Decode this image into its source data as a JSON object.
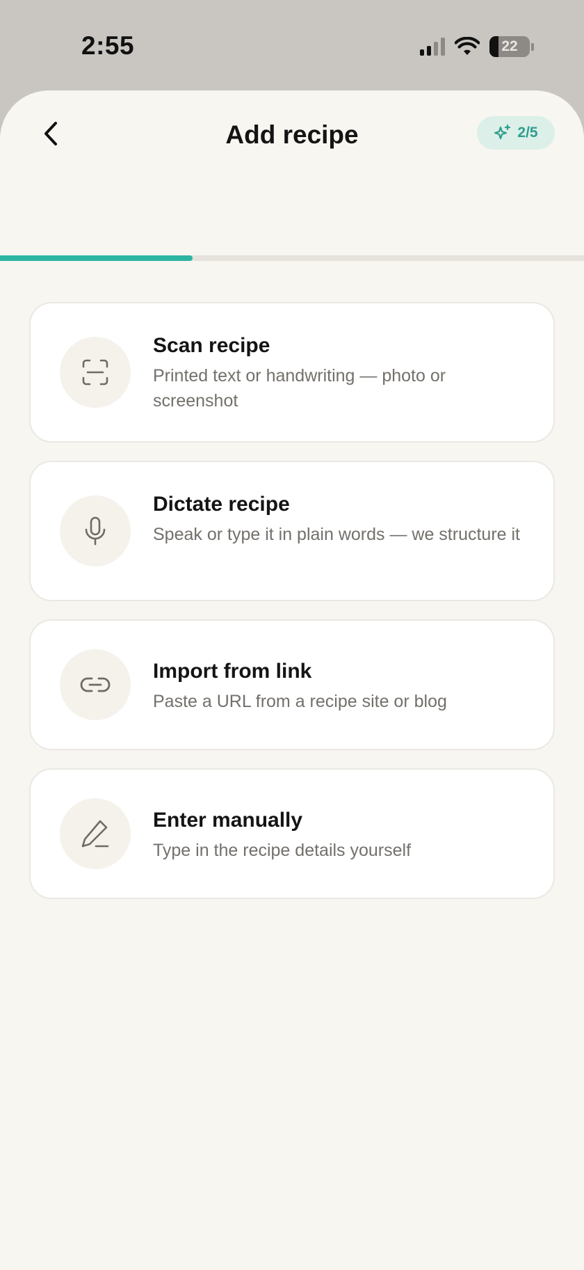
{
  "status_bar": {
    "time": "2:55",
    "battery": "22"
  },
  "header": {
    "title": "Add recipe",
    "step_indicator": "2/5",
    "back_icon": "chevron-left-icon",
    "badge_icon": "sparkles-icon"
  },
  "progress": {
    "current_step": 2,
    "total_steps": 5,
    "fraction": 0.33
  },
  "colors": {
    "accent": "#2eb5a1",
    "background": "#f8f6f1",
    "badge_bg": "#dcefe9"
  },
  "options": [
    {
      "title": "Scan recipe",
      "description": "Printed text or handwriting — photo or screenshot",
      "icon": "scan-icon"
    },
    {
      "title": "Dictate recipe",
      "description": "Speak or type it in plain words — we structure it",
      "icon": "microphone-icon"
    },
    {
      "title": "Import from link",
      "description": "Paste a URL from a recipe site or blog",
      "icon": "link-icon"
    },
    {
      "title": "Enter manually",
      "description": "Type in the recipe details yourself",
      "icon": "pencil-icon"
    }
  ]
}
